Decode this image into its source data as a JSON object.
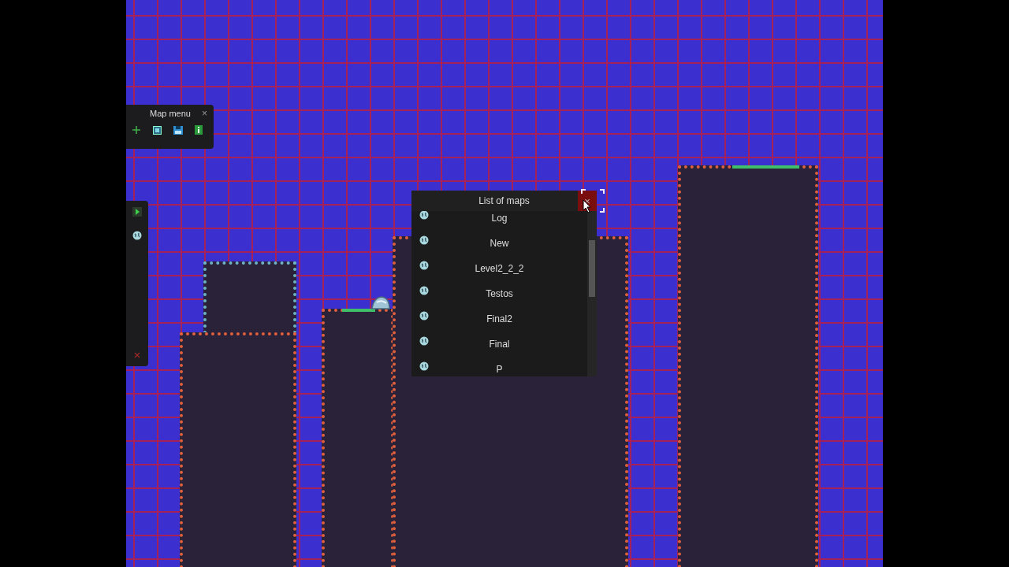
{
  "map_menu": {
    "title": "Map menu",
    "close": "×",
    "tools": [
      {
        "kind": "add"
      },
      {
        "kind": "square"
      },
      {
        "kind": "save"
      },
      {
        "kind": "info"
      }
    ]
  },
  "side_toolbar": {
    "tools": [
      {
        "kind": "play"
      },
      {
        "kind": "globe"
      },
      {
        "kind": "close"
      }
    ]
  },
  "list_of_maps": {
    "title": "List of maps",
    "close": "×",
    "items": [
      {
        "name": "Log"
      },
      {
        "name": "New"
      },
      {
        "name": "Level2_2_2"
      },
      {
        "name": "Testos"
      },
      {
        "name": "Final2"
      },
      {
        "name": "Final"
      },
      {
        "name": "P"
      }
    ]
  }
}
